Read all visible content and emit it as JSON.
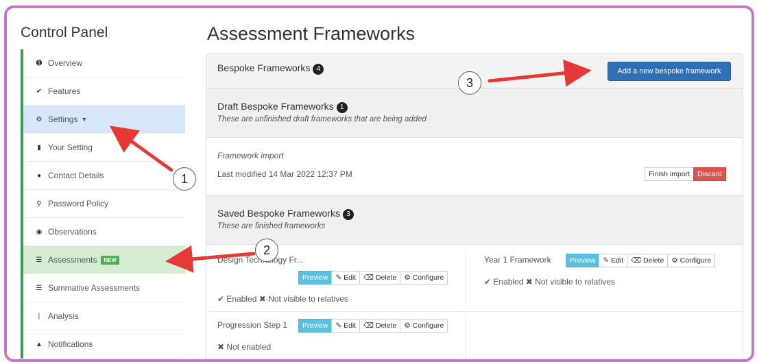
{
  "sidebar": {
    "title": "Control Panel",
    "items": [
      {
        "label": "Overview",
        "icon": "info-icon"
      },
      {
        "label": "Features",
        "icon": "check-icon"
      },
      {
        "label": "Settings",
        "icon": "gear-icon"
      },
      {
        "label": "Your Setting",
        "icon": "bookmark-icon"
      },
      {
        "label": "Contact Details",
        "icon": "comment-icon"
      },
      {
        "label": "Password Policy",
        "icon": "key-icon"
      },
      {
        "label": "Observations",
        "icon": "eye-icon"
      },
      {
        "label": "Assessments",
        "icon": "list-icon",
        "badge": "NEW"
      },
      {
        "label": "Summative Assessments",
        "icon": "list-icon"
      },
      {
        "label": "Analysis",
        "icon": "chart-icon"
      },
      {
        "label": "Notifications",
        "icon": "bell-icon"
      }
    ]
  },
  "main": {
    "title": "Assessment Frameworks",
    "bespoke": {
      "label": "Bespoke Frameworks",
      "count": "4",
      "add_button": "Add a new bespoke framework"
    },
    "draft": {
      "label": "Draft Bespoke Frameworks",
      "count": "1",
      "subtitle": "These are unfinished draft frameworks that are being added",
      "item": {
        "name": "Framework import",
        "modified": "Last modified 14 Mar 2022 12:37 PM",
        "finish_label": "Finish import",
        "discard_label": "Discard"
      }
    },
    "saved": {
      "label": "Saved Bespoke Frameworks",
      "count": "3",
      "subtitle": "These are finished frameworks",
      "frameworks": [
        {
          "name": "Design Technology Fr...",
          "status_enabled": "Enabled",
          "status_visible": "Not visible to relatives"
        },
        {
          "name": "Year 1 Framework",
          "status_enabled": "Enabled",
          "status_visible": "Not visible to relatives"
        },
        {
          "name": "Progression Step 1",
          "status_enabled": "Not enabled"
        }
      ]
    },
    "actions": {
      "preview": "Preview",
      "edit": "Edit",
      "delete": "Delete",
      "configure": "Configure"
    }
  },
  "annotations": {
    "one": "1",
    "two": "2",
    "three": "3"
  },
  "colors": {
    "accent_blue": "#2e6fb5",
    "preview": "#5bc0de",
    "discard": "#d9534f",
    "arrow": "#e53935",
    "frame": "#c678c8"
  }
}
